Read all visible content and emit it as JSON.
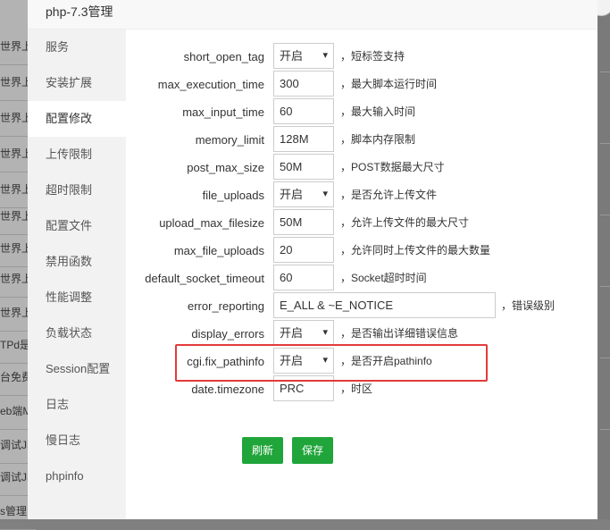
{
  "background_rows": [
    "世界上",
    "世界上",
    "世界上",
    "世界上",
    "世界上",
    "世界上",
    "世界上",
    "世界上",
    "世界上",
    "TPd是",
    "台免费",
    "eb端M",
    "调试JS",
    "调试JS",
    "s管理"
  ],
  "dialog": {
    "title": "php-7.3管理",
    "menu": [
      "服务",
      "安装扩展",
      "配置修改",
      "上传限制",
      "超时限制",
      "配置文件",
      "禁用函数",
      "性能调整",
      "负载状态",
      "Session配置",
      "日志",
      "慢日志",
      "phpinfo"
    ],
    "active_menu": "配置修改"
  },
  "settings": [
    {
      "name": "short_open_tag",
      "value": "开启",
      "type": "select",
      "desc": "，短标签支持"
    },
    {
      "name": "max_execution_time",
      "value": "300",
      "type": "input",
      "desc": "，最大脚本运行时间"
    },
    {
      "name": "max_input_time",
      "value": "60",
      "type": "input",
      "desc": "，最大输入时间"
    },
    {
      "name": "memory_limit",
      "value": "128M",
      "type": "input",
      "desc": "，脚本内存限制"
    },
    {
      "name": "post_max_size",
      "value": "50M",
      "type": "input",
      "desc": "，POST数据最大尺寸"
    },
    {
      "name": "file_uploads",
      "value": "开启",
      "type": "select",
      "desc": "，是否允许上传文件"
    },
    {
      "name": "upload_max_filesize",
      "value": "50M",
      "type": "input",
      "desc": "，允许上传文件的最大尺寸"
    },
    {
      "name": "max_file_uploads",
      "value": "20",
      "type": "input",
      "desc": "，允许同时上传文件的最大数量"
    },
    {
      "name": "default_socket_timeout",
      "value": "60",
      "type": "input",
      "desc": "，Socket超时时间"
    },
    {
      "name": "error_reporting",
      "value": "E_ALL & ~E_NOTICE",
      "type": "input-wide",
      "desc": "，错误级别"
    },
    {
      "name": "display_errors",
      "value": "开启",
      "type": "select",
      "desc": "，是否输出详细错误信息"
    },
    {
      "name": "cgi.fix_pathinfo",
      "value": "开启",
      "type": "select",
      "desc": "，是否开启pathinfo"
    },
    {
      "name": "date.timezone",
      "value": "PRC",
      "type": "input",
      "desc": "，时区"
    }
  ],
  "buttons": {
    "refresh": "刷新",
    "save": "保存"
  },
  "colors": {
    "button_green": "#20a53a",
    "highlight_red": "#e33b3b"
  }
}
